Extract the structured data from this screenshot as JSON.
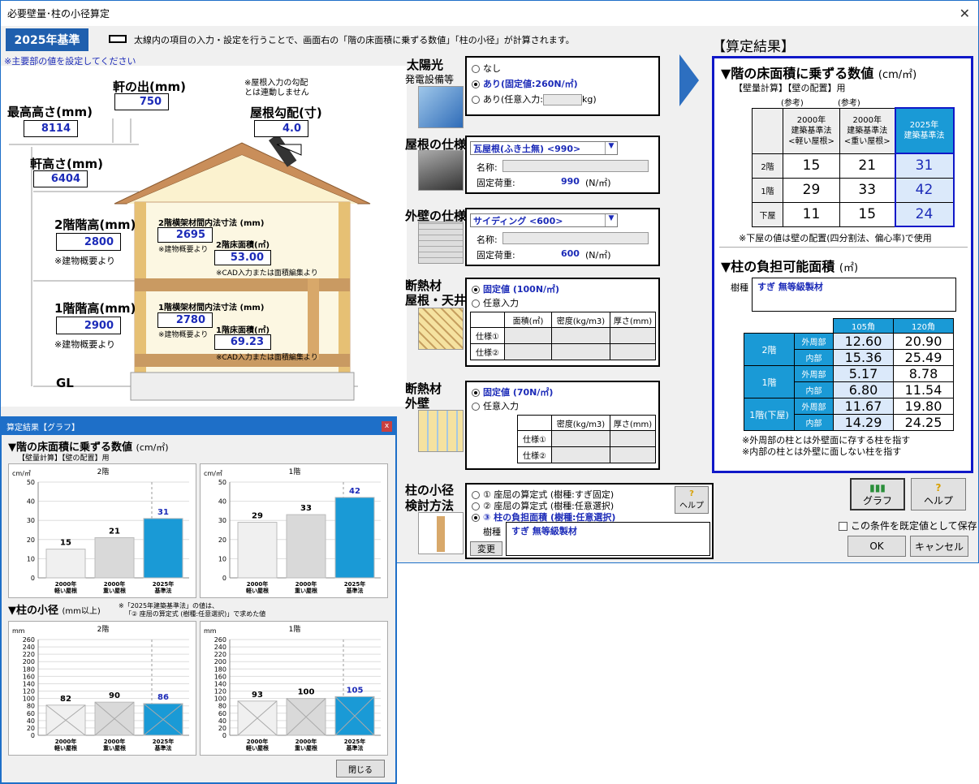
{
  "window": {
    "title": "必要壁量･柱の小径算定",
    "close": "✕"
  },
  "badge": "2025年基準",
  "instruction": "太線内の項目の入力・設定を行うことで、画面右の「階の床面積に乗ずる数値」「柱の小径」が計算されます。",
  "note_main": "※主要部の値を設定してください",
  "house": {
    "max_height_label": "最高高さ(mm)",
    "max_height": "8114",
    "eave_out_label": "軒の出(mm)",
    "eave_out": "750",
    "roof_note": "※屋根入力の勾配\nとは連動しません",
    "roof_pitch_label": "屋根勾配(寸)",
    "roof_pitch": "4.0",
    "eave_height_label": "軒高さ(mm)",
    "eave_height": "6404",
    "f2_height_label": "2階階高(mm)",
    "f2_height": "2800",
    "f2_note": "※建物概要より",
    "f1_height_label": "1階階高(mm)",
    "f1_height": "2900",
    "f1_note": "※建物概要より",
    "gl": "GL",
    "f2_beam_label": "2階横架材間内法寸法 (mm)",
    "f2_beam": "2695",
    "f2_beam_note": "※建物概要より",
    "f2_area_label": "2階床面積(㎡)",
    "f2_area": "53.00",
    "f2_area_note": "※CAD入力または面積編集より",
    "f1_beam_label": "1階横架材間内法寸法 (mm)",
    "f1_beam": "2780",
    "f1_beam_note": "※建物概要より",
    "f1_area_label": "1階床面積(㎡)",
    "f1_area": "69.23",
    "f1_area_note": "※CAD入力または面積編集より"
  },
  "solar": {
    "title": "太陽光",
    "sub": "発電設備等",
    "opt1": "なし",
    "opt2": "あり(固定値:260N/㎡)",
    "opt3": "あり(任意入力:",
    "unit": "kg)"
  },
  "roof": {
    "title": "屋根の仕様",
    "select": "瓦屋根(ふき土無) <990>",
    "name_label": "名称:",
    "load_label": "固定荷重:",
    "load": "990",
    "unit": "(N/㎡)"
  },
  "wall": {
    "title": "外壁の仕様",
    "select": "サイディング <600>",
    "name_label": "名称:",
    "load_label": "固定荷重:",
    "load": "600",
    "unit": "(N/㎡)"
  },
  "ins_roof": {
    "title1": "断熱材",
    "title2": "屋根・天井",
    "opt1": "固定値 (100N/㎡)",
    "opt2": "任意入力",
    "h1": "面積(㎡)",
    "h2": "密度(kg/m3)",
    "h3": "厚さ(mm)",
    "r1": "仕様①",
    "r2": "仕様②"
  },
  "ins_wall": {
    "title1": "断熱材",
    "title2": "外壁",
    "opt1": "固定値 (70N/㎡)",
    "opt2": "任意入力",
    "h2": "密度(kg/m3)",
    "h3": "厚さ(mm)",
    "r1": "仕様①",
    "r2": "仕様②"
  },
  "column": {
    "title1": "柱の小径",
    "title2": "検討方法",
    "opt1": "① 座屈の算定式 (樹種:すぎ固定)",
    "opt2": "② 座屈の算定式 (樹種:任意選択)",
    "opt3": "③ 柱の負担面積 (樹種:任意選択)",
    "help": "ヘルプ",
    "species_label": "樹種",
    "species": "すぎ 無等級製材",
    "change": "変更"
  },
  "result": {
    "heading": "【算定結果】",
    "floor_title": "▼階の床面積に乗ずる数値",
    "floor_unit": "(cm/㎡)",
    "floor_sub": "【壁量計算】【壁の配置】用",
    "ref1": "(参考)",
    "ref2": "(参考)",
    "headers": [
      "2000年\n建築基準法\n<軽い屋根>",
      "2000年\n建築基準法\n<重い屋根>",
      "2025年\n建築基準法"
    ],
    "rows": [
      {
        "name": "2階",
        "v": [
          "15",
          "21",
          "31"
        ]
      },
      {
        "name": "1階",
        "v": [
          "29",
          "33",
          "42"
        ]
      },
      {
        "name": "下屋",
        "v": [
          "11",
          "15",
          "24"
        ]
      }
    ],
    "floor_note": "※下屋の値は壁の配置(四分割法、偏心率)で使用",
    "col_title": "▼柱の負担可能面積",
    "col_unit": "(㎡)",
    "species_label": "樹種",
    "species": "すぎ 無等級製材",
    "col_headers": [
      "105角",
      "120角"
    ],
    "col_rows": [
      {
        "floor": "2階",
        "part": "外周部",
        "v": [
          "12.60",
          "20.90"
        ]
      },
      {
        "floor": "",
        "part": "内部",
        "v": [
          "15.36",
          "25.49"
        ]
      },
      {
        "floor": "1階",
        "part": "外周部",
        "v": [
          "5.17",
          "8.78"
        ]
      },
      {
        "floor": "",
        "part": "内部",
        "v": [
          "6.80",
          "11.54"
        ]
      },
      {
        "floor": "1階(下屋)",
        "part": "外周部",
        "v": [
          "11.67",
          "19.80"
        ]
      },
      {
        "floor": "",
        "part": "内部",
        "v": [
          "14.29",
          "24.25"
        ]
      }
    ],
    "col_note1": "※外周部の柱とは外壁面に存する柱を指す",
    "col_note2": "※内部の柱とは外壁に面しない柱を指す"
  },
  "buttons": {
    "graph": "グラフ",
    "help": "ヘルプ",
    "save_default": "この条件を既定値として保存",
    "ok": "OK",
    "cancel": "キャンセル"
  },
  "graph": {
    "title": "算定結果【グラフ】",
    "sec1": "▼階の床面積に乗ずる数値",
    "sec1_unit": "(cm/㎡)",
    "sec1_sub": "【壁量計算】【壁の配置】用",
    "sec2": "▼柱の小径",
    "sec2_unit": "(mm以上)",
    "sec2_note1": "※「2025年建築基準法」の値は、",
    "sec2_note2": "「② 座屈の算定式 (樹種:任意選択)」で求めた値",
    "close": "閉じる",
    "unit_a": "cm/㎡",
    "unit_b": "mm"
  },
  "chart_data": [
    {
      "type": "bar",
      "title": "2階",
      "ylabel": "cm/㎡",
      "ylim": [
        0,
        50
      ],
      "categories": [
        "2000年\n軽い屋根",
        "2000年\n重い屋根",
        "2025年\n基準法"
      ],
      "values": [
        15,
        21,
        31
      ],
      "colors": [
        "#f0f0f0",
        "#d9d9d9",
        "#1a9ad6"
      ]
    },
    {
      "type": "bar",
      "title": "1階",
      "ylabel": "cm/㎡",
      "ylim": [
        0,
        50
      ],
      "categories": [
        "2000年\n軽い屋根",
        "2000年\n重い屋根",
        "2025年\n基準法"
      ],
      "values": [
        29,
        33,
        42
      ],
      "colors": [
        "#f0f0f0",
        "#d9d9d9",
        "#1a9ad6"
      ]
    },
    {
      "type": "bar",
      "title": "2階",
      "ylabel": "mm",
      "ylim": [
        0,
        260
      ],
      "categories": [
        "2000年\n軽い屋根",
        "2000年\n重い屋根",
        "2025年\n基準法"
      ],
      "values": [
        82,
        90,
        86
      ],
      "colors": [
        "#f0f0f0",
        "#d9d9d9",
        "#1a9ad6"
      ]
    },
    {
      "type": "bar",
      "title": "1階",
      "ylabel": "mm",
      "ylim": [
        0,
        260
      ],
      "categories": [
        "2000年\n軽い屋根",
        "2000年\n重い屋根",
        "2025年\n基準法"
      ],
      "values": [
        93,
        100,
        105
      ],
      "colors": [
        "#f0f0f0",
        "#d9d9d9",
        "#1a9ad6"
      ]
    }
  ]
}
